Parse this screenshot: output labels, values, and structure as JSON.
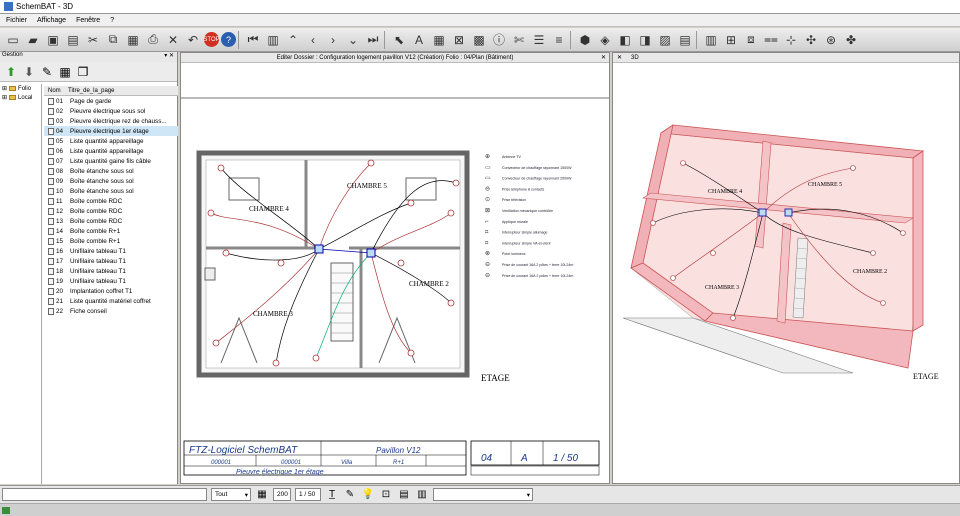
{
  "window": {
    "title": "SchemBAT - 3D"
  },
  "menu": [
    "Fichier",
    "Affichage",
    "Fenêtre",
    "?"
  ],
  "left_panel": {
    "header": "Gestion",
    "tree": [
      "Folio",
      "Local"
    ],
    "columns": [
      "Nom",
      "Titre_de_la_page"
    ],
    "rows": [
      {
        "num": "01",
        "title": "Page de garde"
      },
      {
        "num": "02",
        "title": "Pieuvre électrique sous sol"
      },
      {
        "num": "03",
        "title": "Pieuvre électrique rez de chauss..."
      },
      {
        "num": "04",
        "title": "Pieuvre électrique 1er étage"
      },
      {
        "num": "05",
        "title": "Liste quantité appareillage"
      },
      {
        "num": "06",
        "title": "Liste quantité appareillage"
      },
      {
        "num": "07",
        "title": "Liste quantité gaine fils câble"
      },
      {
        "num": "08",
        "title": "Boîte étanche sous sol"
      },
      {
        "num": "09",
        "title": "Boîte étanche sous sol"
      },
      {
        "num": "10",
        "title": "Boîte étanche sous sol"
      },
      {
        "num": "11",
        "title": "Boîte comble RDC"
      },
      {
        "num": "12",
        "title": "Boîte comble RDC"
      },
      {
        "num": "13",
        "title": "Boîte comble RDC"
      },
      {
        "num": "14",
        "title": "Boîte comble R+1"
      },
      {
        "num": "15",
        "title": "Boîte comble R+1"
      },
      {
        "num": "16",
        "title": "Unifilaire tableau T1"
      },
      {
        "num": "17",
        "title": "Unifilaire tableau T1"
      },
      {
        "num": "18",
        "title": "Unifilaire tableau T1"
      },
      {
        "num": "19",
        "title": "Unifilaire tableau T1"
      },
      {
        "num": "20",
        "title": "Implantation coffret T1"
      },
      {
        "num": "21",
        "title": "Liste quantité matériel coffret"
      },
      {
        "num": "22",
        "title": "Fiche conseil"
      }
    ]
  },
  "editor": {
    "tab_title": "Editer Dossier : Configuration logement pavillon V12 (Création) Folio : 04/Plan (Bâtiment)",
    "rooms": [
      "CHAMBRE 4",
      "CHAMBRE 5",
      "CHAMBRE 2",
      "CHAMBRE 3"
    ],
    "floor_label": "ETAGE",
    "legend": [
      "Antenne TV",
      "Convecteur de chauffage rayonnant 1500W",
      "Convecteur de chauffage rayonnant 2000W",
      "Prise téléphone 8 contacts",
      "Prise télévision",
      "Ventilation mécanique contrôlée",
      "Applique murale",
      "Interrupteur simple allumage",
      "Interrupteur simple VA-et-vient",
      "Point lumineux",
      "Prise de courant 16A 2 pôles + terre 10L24m",
      "Prise de courant 16A 2 pôles + terre 10L24m"
    ],
    "title_block": {
      "company": "FTZ-Logiciel SchemBAT",
      "project": "Pavillon V12",
      "num1": "000001",
      "num2": "000001",
      "type": "Villa",
      "level": "R+1",
      "page_title": "Pieuvre électrique 1er étage",
      "folio": "04",
      "index": "A",
      "scale": "1 / 50"
    }
  },
  "view3d": {
    "tab_title": "3D",
    "rooms": [
      "CHAMBRE 4",
      "CHAMBRE 5",
      "CHAMBRE 3",
      "CHAMBRE 2"
    ],
    "floor_label": "ETAGE"
  },
  "statusbar": {
    "layer_select": "Tout",
    "zoom": "200",
    "page_counter": "1 / 50"
  }
}
